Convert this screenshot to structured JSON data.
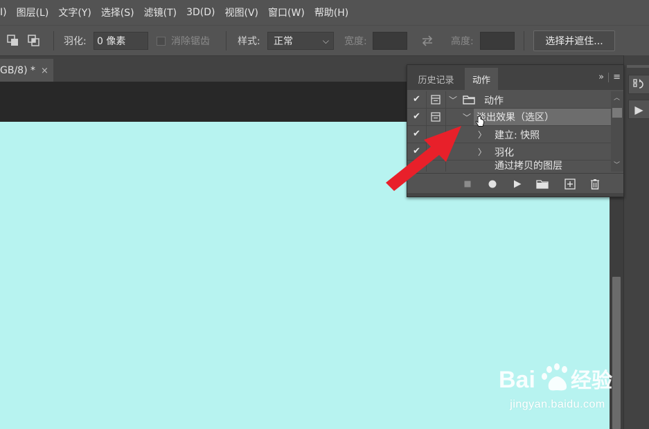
{
  "menu": {
    "items": [
      "I)",
      "图层(L)",
      "文字(Y)",
      "选择(S)",
      "滤镜(T)",
      "3D(D)",
      "视图(V)",
      "窗口(W)",
      "帮助(H)"
    ]
  },
  "options": {
    "feather_label": "羽化:",
    "feather_value": "0 像素",
    "antialias_label": "消除锯齿",
    "style_label": "样式:",
    "style_value": "正常",
    "width_label": "宽度:",
    "height_label": "高度:",
    "select_mask_button": "选择并遮住..."
  },
  "document_tab": {
    "title": "GB/8) *",
    "close": "×"
  },
  "panel": {
    "tab_history": "历史记录",
    "tab_actions": "动作",
    "expand_icon": "»",
    "menu_icon": "≡",
    "rows": [
      {
        "checked": true,
        "dialog": true,
        "expanded": true,
        "type": "folder",
        "label": "动作"
      },
      {
        "checked": true,
        "dialog": true,
        "expanded": true,
        "type": "action",
        "label": "淡出效果（选区）",
        "selected": true
      },
      {
        "checked": true,
        "dialog": false,
        "expanded": false,
        "type": "step",
        "label": "建立: 快照"
      },
      {
        "checked": true,
        "dialog": false,
        "expanded": false,
        "type": "step",
        "label": "羽化"
      },
      {
        "checked": true,
        "dialog": false,
        "expanded": false,
        "type": "step",
        "label": "通过拷贝的图层"
      }
    ],
    "footer_icons": [
      "stop-icon",
      "record-icon",
      "play-icon",
      "new-set-icon",
      "new-action-icon",
      "delete-icon"
    ]
  },
  "watermark": {
    "brand": "Bai du 经验",
    "url": "jingyan.baidu.com"
  },
  "colors": {
    "canvas": "#b7f3f0",
    "arrow": "#e8202a",
    "ui_bg": "#535353"
  }
}
